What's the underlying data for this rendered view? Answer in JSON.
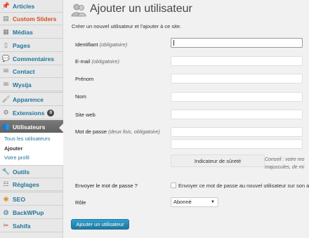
{
  "sidebar": {
    "items": [
      {
        "label": "Articles",
        "icon": "pin-icon"
      },
      {
        "label": "Custom Sliders",
        "icon": "slider-icon"
      },
      {
        "label": "Médias",
        "icon": "media-icon"
      },
      {
        "label": "Pages",
        "icon": "page-icon"
      },
      {
        "label": "Commentaires",
        "icon": "comment-icon"
      },
      {
        "label": "Contact",
        "icon": "contact-icon"
      },
      {
        "label": "Wysija",
        "icon": "mail-icon"
      },
      {
        "label": "Apparence",
        "icon": "appearance-icon"
      },
      {
        "label": "Extensions",
        "icon": "plugin-icon",
        "badge": "0"
      },
      {
        "label": "Utilisateurs",
        "icon": "users-icon"
      },
      {
        "label": "Outils",
        "icon": "tools-icon"
      },
      {
        "label": "Réglages",
        "icon": "settings-icon"
      },
      {
        "label": "SEO",
        "icon": "seo-icon"
      },
      {
        "label": "BackWPup",
        "icon": "backup-icon"
      },
      {
        "label": "Sahifa",
        "icon": "sahifa-icon"
      }
    ],
    "submenu": [
      "Tous les utilisateurs",
      "Ajouter",
      "Votre profil"
    ]
  },
  "page": {
    "title": "Ajouter un utilisateur",
    "intro": "Créer un nouvel utilisateur et l'ajouter à ce site."
  },
  "form": {
    "username_label": "Identifiant",
    "username_note": "(obligatoire)",
    "email_label": "E-mail",
    "email_note": "(obligatoire)",
    "firstname_label": "Prénom",
    "lastname_label": "Nom",
    "website_label": "Site web",
    "password_label": "Mot de passe",
    "password_note": "(deux fois, obligatoire)",
    "strength_label": "Indicateur de sûreté",
    "hint_line1": "Conseil : votre mo",
    "hint_line2": "majuscules, de mi",
    "send_label": "Envoyer le mot de passe ?",
    "send_checkbox_label": "Envoyer ce mot de passe au nouvel utilisateur sur son a",
    "role_label": "Rôle",
    "role_value": "Abonné",
    "submit_label": "Ajouter un utilisateur"
  }
}
